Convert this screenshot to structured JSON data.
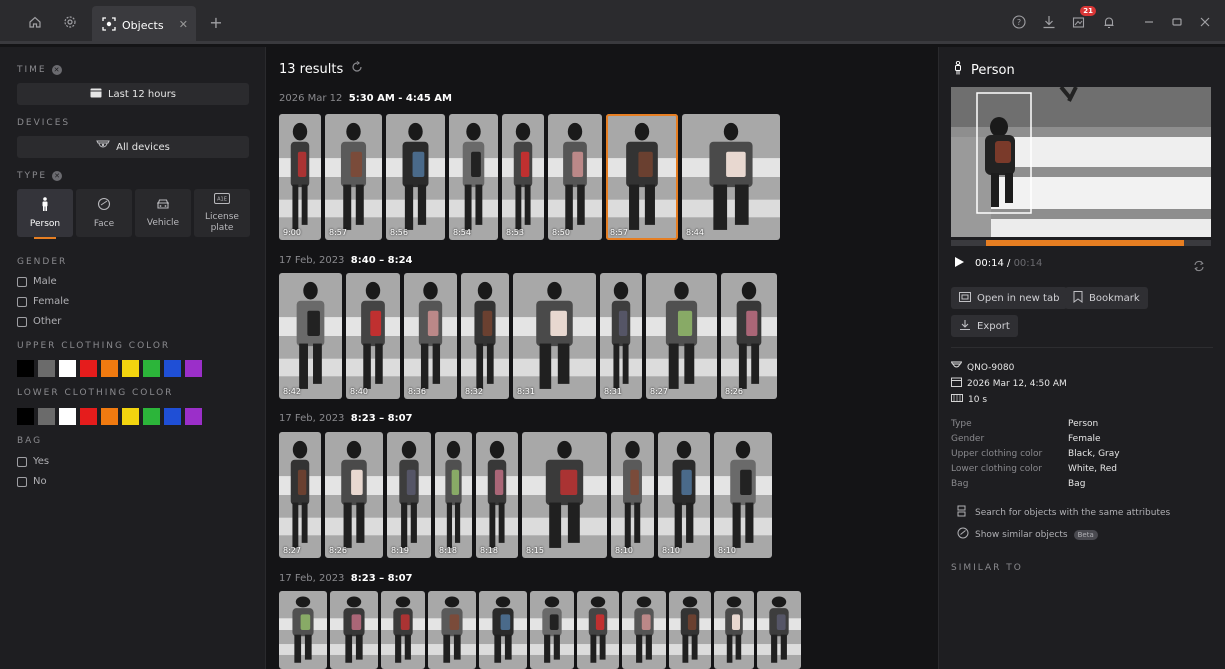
{
  "titlebar": {
    "tab_label": "Objects",
    "notification_count": "21",
    "icons": [
      "home-icon",
      "settings-icon",
      "objects-icon",
      "close-icon",
      "plus-icon",
      "help-icon",
      "download-icon",
      "notification-icon",
      "bell-icon",
      "minimize-icon",
      "maximize-icon",
      "window-close-icon"
    ]
  },
  "filters": {
    "time": {
      "title": "TIME",
      "value": "Last 12 hours"
    },
    "devices": {
      "title": "DEVICES",
      "value": "All devices"
    },
    "type": {
      "title": "TYPE",
      "options": [
        {
          "label": "Person",
          "icon": "person-icon",
          "active": true
        },
        {
          "label": "Face",
          "icon": "face-icon",
          "active": false
        },
        {
          "label": "Vehicle",
          "icon": "vehicle-icon",
          "active": false
        },
        {
          "label": "License plate",
          "icon": "license-plate-icon",
          "active": false
        }
      ]
    },
    "gender": {
      "title": "GENDER",
      "options": [
        "Male",
        "Female",
        "Other"
      ]
    },
    "upper_color": {
      "title": "UPPER CLOTHING COLOR"
    },
    "lower_color": {
      "title": "LOWER CLOTHING COLOR"
    },
    "colors": [
      "#000000",
      "#6b6b6b",
      "#ffffff",
      "#e51c1c",
      "#f07a10",
      "#f2d40f",
      "#2cb53a",
      "#1f4fd6",
      "#9b2fc9"
    ],
    "bag": {
      "title": "BAG",
      "options": [
        "Yes",
        "No"
      ]
    }
  },
  "results": {
    "count_label": "13 results",
    "groups": [
      {
        "date": "2026 Mar 12",
        "range": "5:30 AM - 4:45 AM",
        "times": [
          "9:00",
          "8:57",
          "8:56",
          "8:54",
          "8:53",
          "8:50",
          "8:57",
          "8:44"
        ]
      },
      {
        "date": "17 Feb, 2023",
        "range": "8:40 – 8:24",
        "times": [
          "8:42",
          "8:40",
          "8:36",
          "8:32",
          "8:31",
          "8:31",
          "8:27",
          "8:26"
        ]
      },
      {
        "date": "17 Feb, 2023",
        "range": "8:23 – 8:07",
        "times": [
          "8:27",
          "8:26",
          "8:19",
          "8:18",
          "8:18",
          "8:15",
          "8:10",
          "8:10",
          "8:10"
        ]
      },
      {
        "date": "17 Feb, 2023",
        "range": "8:23 – 8:07",
        "times": []
      }
    ]
  },
  "detail": {
    "title": "Person",
    "time_current": "00:14 /",
    "time_total": "00:14",
    "progress": 0.88,
    "buttons": {
      "open_tab": "Open in new tab",
      "bookmark": "Bookmark",
      "export": "Export"
    },
    "device": "QNO-9080",
    "datetime": "2026 Mar 12, 4:50 AM",
    "duration": "10 s",
    "attributes": [
      {
        "key": "Type",
        "value": "Person"
      },
      {
        "key": "Gender",
        "value": "Female"
      },
      {
        "key": "Upper clothing color",
        "value": "Black, Gray"
      },
      {
        "key": "Lower clothing color",
        "value": "White, Red"
      },
      {
        "key": "Bag",
        "value": "Bag"
      }
    ],
    "search_same": "Search for objects with the same attributes",
    "show_similar": "Show similar objects",
    "beta": "Beta",
    "similar_title": "SIMILAR TO"
  }
}
